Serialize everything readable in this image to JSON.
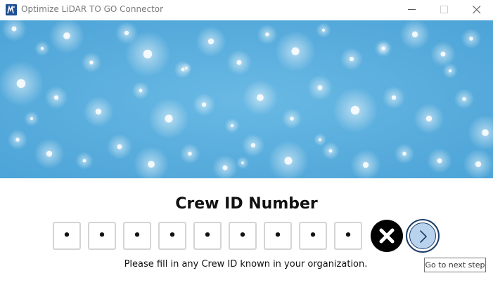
{
  "window": {
    "title": "Optimize LiDAR TO GO Connector"
  },
  "main": {
    "heading": "Crew ID Number",
    "digits": [
      "•",
      "•",
      "•",
      "•",
      "•",
      "•",
      "•",
      "•",
      "•"
    ],
    "hint": "Please fill in any Crew ID known in your organization.",
    "next_tooltip": "Go to next step"
  },
  "colors": {
    "banner_sky": "#5aaedd",
    "next_button_fill": "#b9d2ee",
    "next_button_border": "#1e3e6b",
    "clear_button": "#000000"
  },
  "icons": {
    "app": "app-logo-icon",
    "minimize": "minimize-icon",
    "maximize": "maximize-icon",
    "close": "close-icon",
    "clear": "clear-x-icon",
    "next": "chevron-right-icon"
  }
}
